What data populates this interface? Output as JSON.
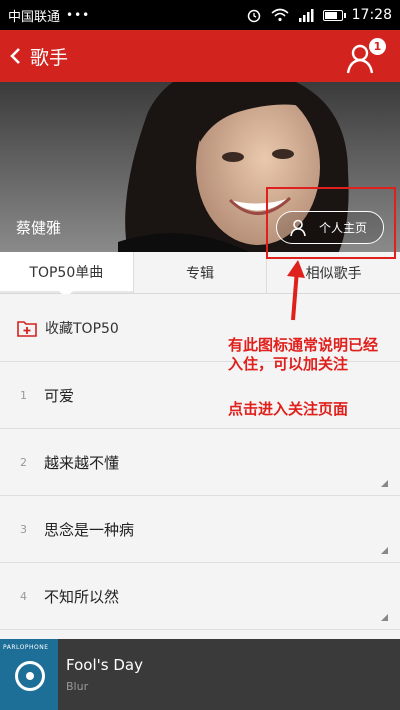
{
  "status_bar": {
    "carrier": "中国联通",
    "dots": "•••",
    "time": "17:28"
  },
  "app_bar": {
    "title": "歌手",
    "badge_count": "1"
  },
  "hero": {
    "singer_name": "蔡健雅",
    "profile_button": "个人主页"
  },
  "tabs": [
    {
      "label": "TOP50单曲"
    },
    {
      "label": "专辑"
    },
    {
      "label": "相似歌手"
    }
  ],
  "collect": {
    "label": "收藏TOP50"
  },
  "songs": [
    {
      "num": "1",
      "title": "可爱"
    },
    {
      "num": "2",
      "title": "越来越不懂"
    },
    {
      "num": "3",
      "title": "思念是一种病"
    },
    {
      "num": "4",
      "title": "不知所以然"
    }
  ],
  "annotations": {
    "note1": "有此图标通常说明已经入住，可以加关注",
    "note2": "点击进入关注页面"
  },
  "player": {
    "cover_brand": "PARLOPHONE",
    "title": "Fool's Day",
    "artist": "Blur"
  },
  "colors": {
    "accent": "#d3231f",
    "annotation": "#e0201c",
    "player_bg": "#3a3a3a"
  }
}
